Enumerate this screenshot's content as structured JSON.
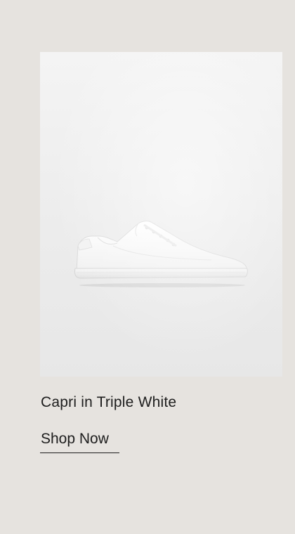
{
  "product": {
    "title": "Capri in Triple White",
    "cta_label": "Shop Now",
    "image_icon": "sneaker-image"
  },
  "colors": {
    "page_background": "#e6e3df",
    "card_background": "#ececec",
    "text": "#1d1d1d"
  }
}
